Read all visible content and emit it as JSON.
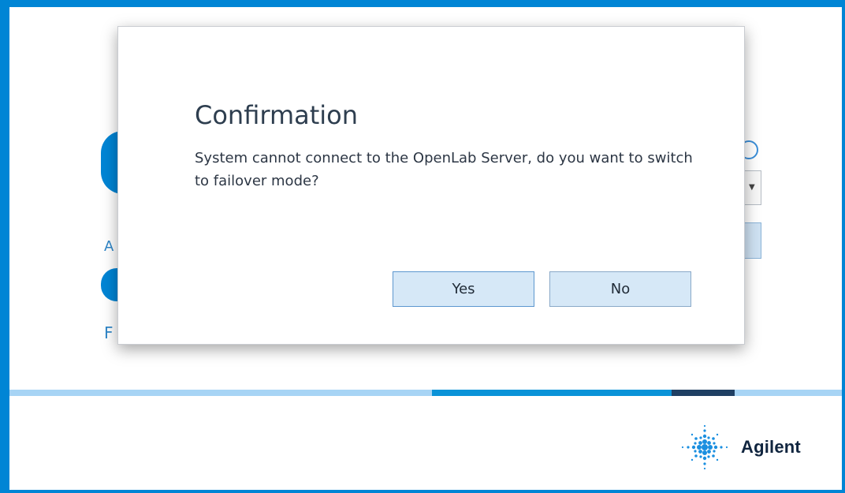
{
  "dialog": {
    "title": "Confirmation",
    "message": "System cannot connect to the OpenLab Server, do you want to switch to failover mode?",
    "yes_label": "Yes",
    "no_label": "No"
  },
  "background": {
    "fragment_a": "A",
    "fragment_f": "F"
  },
  "footer": {
    "logo_text": "Agilent",
    "logo_icon": "agilent-spark-icon"
  },
  "colors": {
    "accent": "#0085d5",
    "dialog_button_bg": "#d6e8f7",
    "logo_text": "#10253f"
  }
}
